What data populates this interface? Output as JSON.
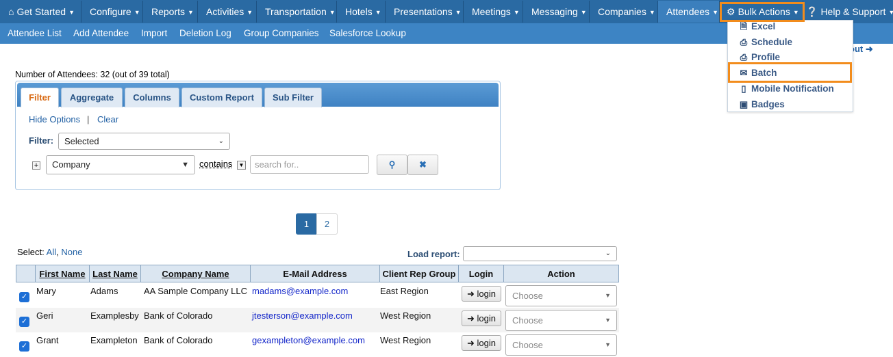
{
  "nav": {
    "items": [
      {
        "label": "Get Started"
      },
      {
        "label": "Configure"
      },
      {
        "label": "Reports"
      },
      {
        "label": "Activities"
      },
      {
        "label": "Transportation"
      },
      {
        "label": "Hotels"
      },
      {
        "label": "Presentations"
      },
      {
        "label": "Meetings"
      },
      {
        "label": "Messaging"
      },
      {
        "label": "Companies"
      },
      {
        "label": "Attendees"
      },
      {
        "label": "Bulk Actions"
      },
      {
        "label": "Help & Support"
      }
    ],
    "active": "Attendees",
    "highlighted": "Bulk Actions"
  },
  "subnav": {
    "items": [
      {
        "label": "Attendee List"
      },
      {
        "label": "Add Attendee"
      },
      {
        "label": "Import"
      },
      {
        "label": "Deletion Log"
      },
      {
        "label": "Group Companies"
      },
      {
        "label": "Salesforce Lookup"
      }
    ]
  },
  "logout_label": "out",
  "bulk_menu": {
    "items": [
      {
        "label": "Excel",
        "icon": "excel-icon"
      },
      {
        "label": "Schedule",
        "icon": "printer-icon"
      },
      {
        "label": "Profile",
        "icon": "printer-icon"
      },
      {
        "label": "Batch",
        "icon": "envelope-icon"
      },
      {
        "label": "Mobile Notification",
        "icon": "mobile-icon"
      },
      {
        "label": "Badges",
        "icon": "badge-icon"
      }
    ],
    "highlighted": "Batch"
  },
  "attendee_count": "Number of Attendees: 32 (out of 39 total)",
  "filter_panel": {
    "tabs": [
      {
        "label": "Filter"
      },
      {
        "label": "Aggregate"
      },
      {
        "label": "Columns"
      },
      {
        "label": "Custom Report"
      },
      {
        "label": "Sub Filter"
      }
    ],
    "active_tab": "Filter",
    "hide_options": "Hide Options",
    "separator": "|",
    "clear": "Clear",
    "filter_label": "Filter:",
    "filter_value": "Selected",
    "field_value": "Company",
    "operator": "contains",
    "search_placeholder": "search for.."
  },
  "pagination": {
    "pages": [
      "1",
      "2"
    ],
    "current": "1"
  },
  "select_line": {
    "label": "Select:",
    "all": "All",
    "comma": ",",
    "none": "None"
  },
  "load_report_label": "Load report:",
  "table": {
    "columns": [
      "First Name",
      "Last Name",
      "Company Name",
      "E-Mail Address",
      "Client Rep Group",
      "Login",
      "Action"
    ],
    "rows": [
      {
        "first": "Mary",
        "last": "Adams",
        "company": "AA Sample Company LLC",
        "email": "madams@example.com",
        "group": "East Region",
        "login": "login",
        "action": "Choose",
        "checked": true
      },
      {
        "first": "Geri",
        "last": "Examplesby",
        "company": "Bank of Colorado",
        "email": "jtesterson@example.com",
        "group": "West Region",
        "login": "login",
        "action": "Choose",
        "checked": true
      },
      {
        "first": "Grant",
        "last": "Exampleton",
        "company": "Bank of Colorado",
        "email": "gexampleton@example.com",
        "group": "West Region",
        "login": "login",
        "action": "Choose",
        "checked": true
      }
    ]
  },
  "colors": {
    "nav": "#2a6aa3",
    "subnav": "#3d84c4",
    "highlight": "#f28c1c",
    "active_tab_text": "#d96b15"
  }
}
